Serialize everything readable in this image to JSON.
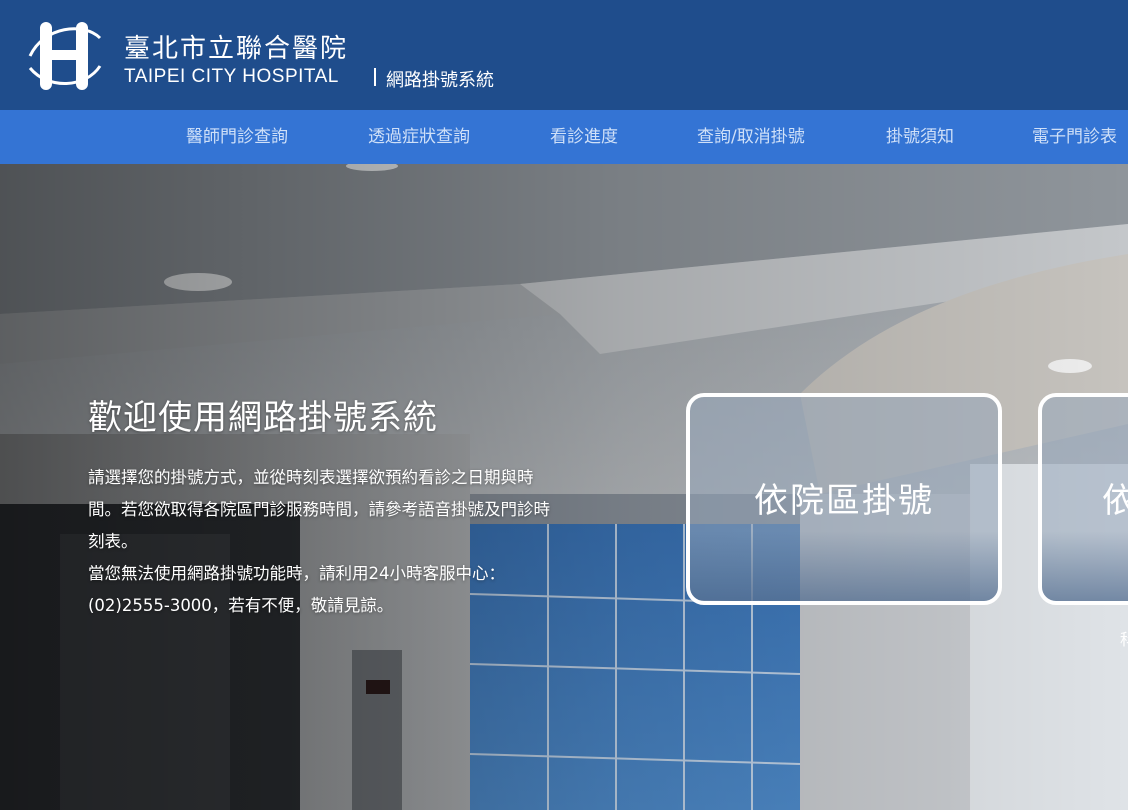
{
  "header": {
    "name_zh": "臺北市立聯合醫院",
    "name_en": "TAIPEI CITY HOSPITAL",
    "system_name": "網路掛號系統",
    "background_color": "#1f4d8c",
    "logo_icon": "hospital-h-logo"
  },
  "nav": {
    "background_color": "#3474d4",
    "items": [
      {
        "label": "醫師門診查詢"
      },
      {
        "label": "透過症狀查詢"
      },
      {
        "label": "看診進度"
      },
      {
        "label": "查詢/取消掛號"
      },
      {
        "label": "掛號須知"
      },
      {
        "label": "電子門診表"
      }
    ]
  },
  "hero": {
    "title": "歡迎使用網路掛號系統",
    "intro_line1": "請選擇您的掛號方式，並從時刻表選擇欲預約看診之日期與時間。若您欲取得各院區門診服務時間，請參考語音掛號及門診時刻表。",
    "intro_line2": "當您無法使用網路掛號功能時，請利用24小時客服中心：(02)2555-3000，若有不便，敬請見諒。",
    "cards": [
      {
        "label": "依院區掛號"
      },
      {
        "label": "依"
      }
    ],
    "fragment": "科"
  }
}
